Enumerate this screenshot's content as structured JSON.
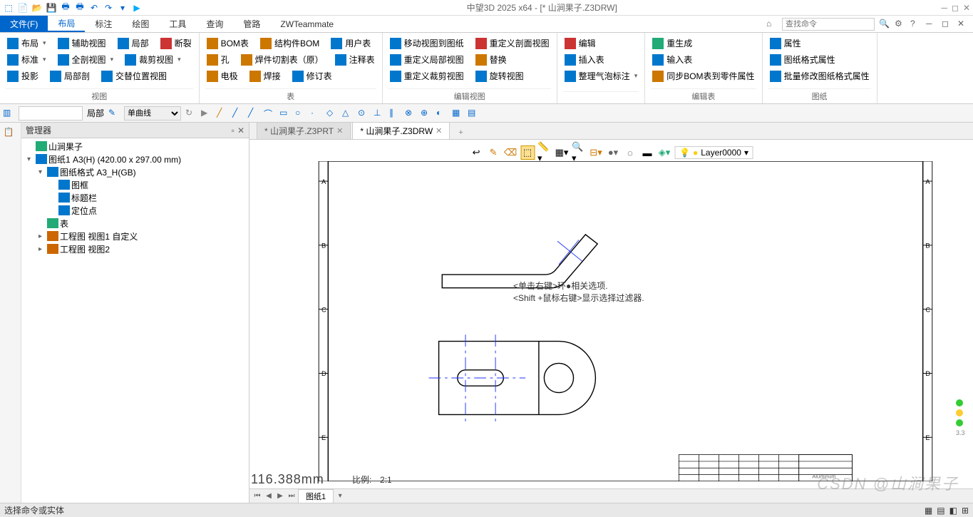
{
  "app": {
    "title": "中望3D 2025 x64 - [* 山涧果子.Z3DRW]"
  },
  "menu": {
    "file": "文件(F)",
    "items": [
      "布局",
      "标注",
      "绘图",
      "工具",
      "查询",
      "管路",
      "ZWTeammate"
    ],
    "active": "布局",
    "search_placeholder": "查找命令"
  },
  "ribbon": {
    "g1": {
      "label": "视图",
      "c1": [
        "布局",
        "标准",
        "投影"
      ],
      "c2": [
        "辅助视图",
        "全剖视图",
        "局部剖"
      ],
      "c3": [
        "局部",
        "裁剪视图",
        "交替位置视图"
      ],
      "c4": [
        "断裂"
      ]
    },
    "g2": {
      "label": "表",
      "c1": [
        "BOM表",
        "孔",
        "电极"
      ],
      "c2": [
        "结构件BOM",
        "焊件切割表（原）",
        "焊接"
      ],
      "c3": [
        "用户表",
        "注释表",
        "修订表"
      ]
    },
    "g3": {
      "label": "编辑视图",
      "c1": [
        "移动视图到图纸",
        "重定义局部视图",
        "重定义裁剪视图"
      ],
      "c2": [
        "重定义剖面视图",
        "替换",
        "旋转视图"
      ]
    },
    "g4": {
      "label": "",
      "c1": [
        "编辑",
        "插入表",
        "整理气泡标注"
      ]
    },
    "g5": {
      "label": "编辑表",
      "c1": [
        "重生成",
        "输入表",
        "同步BOM表到零件属性"
      ]
    },
    "g6": {
      "label": "图纸",
      "c1": [
        "属性",
        "图纸格式属性",
        "批量修改图纸格式属性"
      ]
    }
  },
  "toolbar2": {
    "label1": "局部",
    "curve_type": "单曲线"
  },
  "manager": {
    "title": "管理器",
    "tree": [
      {
        "level": 0,
        "exp": "",
        "icon": "#2a7",
        "text": "山涧果子"
      },
      {
        "level": 0,
        "exp": "▾",
        "icon": "#07c",
        "text": "图纸1 A3(H) (420.00 x 297.00 mm)"
      },
      {
        "level": 1,
        "exp": "▾",
        "icon": "#07c",
        "text": "图纸格式 A3_H(GB)"
      },
      {
        "level": 2,
        "exp": "",
        "icon": "#07c",
        "text": "图框"
      },
      {
        "level": 2,
        "exp": "",
        "icon": "#07c",
        "text": "标题栏"
      },
      {
        "level": 2,
        "exp": "",
        "icon": "#07c",
        "text": "定位点"
      },
      {
        "level": 1,
        "exp": "",
        "icon": "#2a7",
        "text": "表"
      },
      {
        "level": 1,
        "exp": "▸",
        "icon": "#c60",
        "text": "工程图 视图1 自定义"
      },
      {
        "level": 1,
        "exp": "▸",
        "icon": "#c60",
        "text": "工程图 视图2"
      }
    ]
  },
  "tabs": {
    "items": [
      {
        "label": "* 山涧果子.Z3PRT",
        "active": false
      },
      {
        "label": "* 山涧果子.Z3DRW",
        "active": true
      }
    ]
  },
  "hints": {
    "line1": "<单击右键>环●相关选项.",
    "line2": "<Shift +鼠标右键>显示选择过滤器."
  },
  "canvas": {
    "layer": "Layer0000",
    "dimension": "116.388mm",
    "scale_label": "比例:",
    "scale_value": "2:1",
    "grid_labels": [
      "A",
      "B",
      "C",
      "D",
      "E"
    ],
    "titleblock": "Aluminum"
  },
  "sheets": {
    "current": "图纸1"
  },
  "status": {
    "text": "选择命令或实体"
  },
  "watermark": "CSDN @山涧果子",
  "speed": "3.3"
}
